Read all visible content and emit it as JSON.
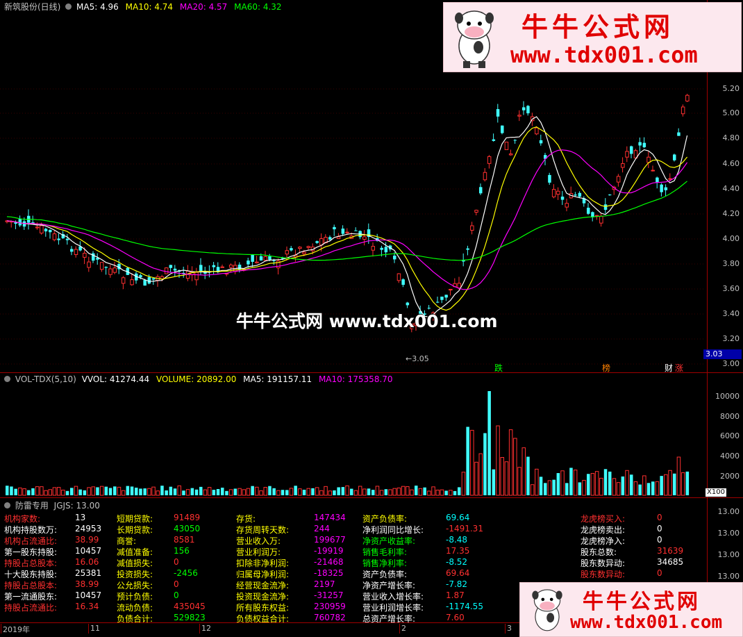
{
  "top_header": {
    "title": "新筑股份(日线)",
    "ma5_label": "MA5: 4.96",
    "ma10_label": "MA10: 4.74",
    "ma20_label": "MA20: 4.57",
    "ma60_label": "MA60: 4.32",
    "colors": {
      "ma5": "#ffffff",
      "ma10": "#ffff00",
      "ma20": "#ff00ff",
      "ma60": "#00ff00"
    }
  },
  "price_axis": [
    "5.20",
    "5.00",
    "4.80",
    "4.60",
    "4.40",
    "4.20",
    "4.00",
    "3.80",
    "3.60",
    "3.40",
    "3.20",
    "3.00"
  ],
  "price_current": "3.03",
  "low_marker": "3.05",
  "event_marks": {
    "m1": "跌",
    "m2": "榜",
    "m3": "财",
    "m4": "涨"
  },
  "center_watermark": "牛牛公式网 www.tdx001.com",
  "volume_header": {
    "name": "VOL-TDX(5,10)",
    "vvol": "VVOL: 41274.44",
    "volume": "VOLUME: 20892.00",
    "ma5": "MA5: 191157.11",
    "ma10": "MA10: 175358.70"
  },
  "volume_axis": [
    "10000",
    "8000",
    "6000",
    "4000",
    "2000"
  ],
  "volume_unit": "X100",
  "fl_header": {
    "name": "防雷专用",
    "jgjs": "JGJS: 13.00"
  },
  "fl_axis": [
    "13.00",
    "13.00",
    "13.00",
    "13.00"
  ],
  "fundamentals": {
    "col1": [
      {
        "label": "机构家数:",
        "value": "13",
        "lc": "#ff3030",
        "vc": "#ffffff"
      },
      {
        "label": "机构持股数万:",
        "value": "24953",
        "lc": "#ffffff",
        "vc": "#ffffff"
      },
      {
        "label": "机构占流通比:",
        "value": "38.99",
        "lc": "#ff3030",
        "vc": "#ff3030"
      },
      {
        "label": "第一股东持股:",
        "value": "10457",
        "lc": "#ffffff",
        "vc": "#ffffff"
      },
      {
        "label": "持股占总股本:",
        "value": "16.06",
        "lc": "#ff3030",
        "vc": "#ff3030"
      },
      {
        "label": "十大股东持股:",
        "value": "25381",
        "lc": "#ffffff",
        "vc": "#ffffff"
      },
      {
        "label": "持股占总股本:",
        "value": "38.99",
        "lc": "#ff3030",
        "vc": "#ff3030"
      },
      {
        "label": "第一流通股东:",
        "value": "10457",
        "lc": "#ffffff",
        "vc": "#ffffff"
      },
      {
        "label": "持股占流通比:",
        "value": "16.34",
        "lc": "#ff3030",
        "vc": "#ff3030"
      }
    ],
    "col2": [
      {
        "label": "短期贷款:",
        "value": "91489",
        "lc": "#ffff00",
        "vc": "#ff3030"
      },
      {
        "label": "长期贷款:",
        "value": "43050",
        "lc": "#ffff00",
        "vc": "#00ff00"
      },
      {
        "label": "商誉:",
        "value": "8581",
        "lc": "#ffff00",
        "vc": "#ff3030"
      },
      {
        "label": "减值准备:",
        "value": "156",
        "lc": "#ffff00",
        "vc": "#00ff00"
      },
      {
        "label": "减值损失:",
        "value": "0",
        "lc": "#ffff00",
        "vc": "#ff3030"
      },
      {
        "label": "投资损失:",
        "value": "-2456",
        "lc": "#ffff00",
        "vc": "#00ff00"
      },
      {
        "label": "公允损失:",
        "value": "0",
        "lc": "#ffff00",
        "vc": "#ff3030"
      },
      {
        "label": "预计负债:",
        "value": "0",
        "lc": "#ffff00",
        "vc": "#00ff00"
      },
      {
        "label": "流动负债:",
        "value": "435045",
        "lc": "#ffff00",
        "vc": "#ff3030"
      },
      {
        "label": "负债合计:",
        "value": "529823",
        "lc": "#ffff00",
        "vc": "#00ff00"
      }
    ],
    "col3": [
      {
        "label": "存货:",
        "value": "147434",
        "lc": "#ffff00",
        "vc": "#ff00ff"
      },
      {
        "label": "存货周转天数:",
        "value": "244",
        "lc": "#ffff00",
        "vc": "#ff00ff"
      },
      {
        "label": "营业收入万:",
        "value": "199677",
        "lc": "#ffff00",
        "vc": "#ff00ff"
      },
      {
        "label": "营业利润万:",
        "value": "-19919",
        "lc": "#ffff00",
        "vc": "#ff00ff"
      },
      {
        "label": "扣除非净利润:",
        "value": "-21468",
        "lc": "#ffff00",
        "vc": "#ff00ff"
      },
      {
        "label": "归属母净利润:",
        "value": "-18325",
        "lc": "#ffff00",
        "vc": "#ff00ff"
      },
      {
        "label": "经营现金流净:",
        "value": "2197",
        "lc": "#ffff00",
        "vc": "#ff00ff"
      },
      {
        "label": "投资现金流净:",
        "value": "-31257",
        "lc": "#ffff00",
        "vc": "#ff00ff"
      },
      {
        "label": "所有股东权益:",
        "value": "230959",
        "lc": "#ffff00",
        "vc": "#ff00ff"
      },
      {
        "label": "负债权益合计:",
        "value": "760782",
        "lc": "#ffff00",
        "vc": "#ff00ff"
      }
    ],
    "col4": [
      {
        "label": "资产负债率:",
        "value": "69.64",
        "lc": "#ffff00",
        "vc": "#00ffff"
      },
      {
        "label": "净利润同比增长:",
        "value": "-1491.31",
        "lc": "#ffffff",
        "vc": "#ff3030"
      },
      {
        "label": "净资产收益率:",
        "value": "-8.48",
        "lc": "#00ff00",
        "vc": "#00ffff"
      },
      {
        "label": "销售毛利率:",
        "value": "17.35",
        "lc": "#00ff00",
        "vc": "#ff3030"
      },
      {
        "label": "销售净利率:",
        "value": "-8.52",
        "lc": "#00ff00",
        "vc": "#00ffff"
      },
      {
        "label": "资产负债率:",
        "value": "69.64",
        "lc": "#ffffff",
        "vc": "#ff3030"
      },
      {
        "label": "净资产增长率:",
        "value": "-7.82",
        "lc": "#ffffff",
        "vc": "#00ffff"
      },
      {
        "label": "营业收入增长率:",
        "value": "1.87",
        "lc": "#ffffff",
        "vc": "#ff3030"
      },
      {
        "label": "营业利润增长率:",
        "value": "-1174.55",
        "lc": "#ffffff",
        "vc": "#00ffff"
      },
      {
        "label": "总资产增长率:",
        "value": "7.60",
        "lc": "#ffffff",
        "vc": "#ff3030"
      }
    ],
    "col5": [
      {
        "label": "龙虎榜买入:",
        "value": "0",
        "lc": "#ff3030",
        "vc": "#ff3030"
      },
      {
        "label": "龙虎榜卖出:",
        "value": "0",
        "lc": "#ffffff",
        "vc": "#ffffff"
      },
      {
        "label": "龙虎榜净入:",
        "value": "0",
        "lc": "#ffffff",
        "vc": "#ffffff"
      },
      {
        "label": "股东总数:",
        "value": "31639",
        "lc": "#ffffff",
        "vc": "#ff3030"
      },
      {
        "label": "股东数异动:",
        "value": "34685",
        "lc": "#ffffff",
        "vc": "#ffffff"
      },
      {
        "label": "股东数异动:",
        "value": "0",
        "lc": "#ff3030",
        "vc": "#ff3030"
      }
    ]
  },
  "date_axis": [
    "2019年",
    "11",
    "12",
    "2",
    "3"
  ],
  "watermark_top": {
    "t1": "牛牛公式网",
    "t2": "www.tdx001.com"
  },
  "watermark_bottom": {
    "t1": "牛牛公式网",
    "t2": "www.tdx001.com"
  },
  "icons": {
    "header_toggle": "circle-toggle-icon",
    "cow_logo": "cow-mascot-icon"
  }
}
